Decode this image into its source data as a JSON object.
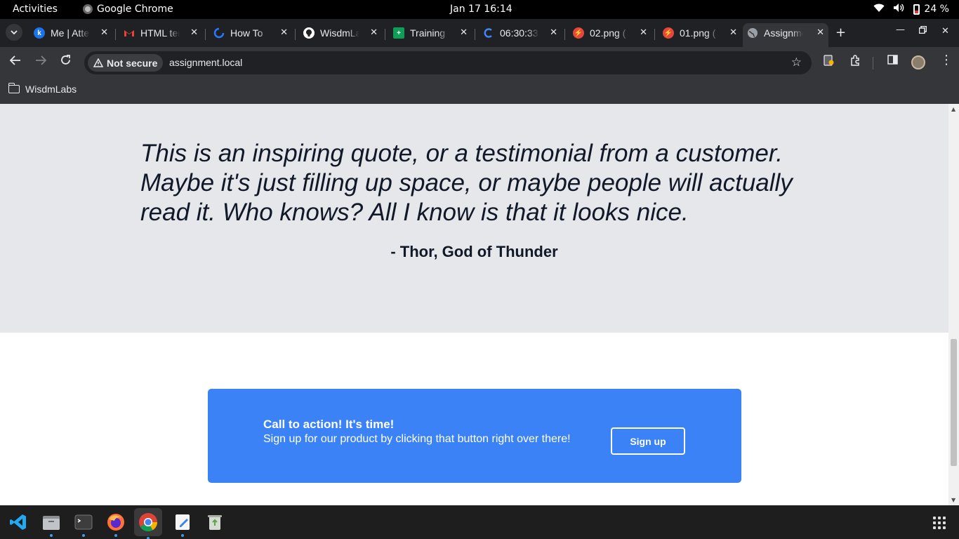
{
  "system": {
    "activities": "Activities",
    "app_name": "Google Chrome",
    "clock": "Jan 17  16:14",
    "battery": "24 %"
  },
  "tabs": [
    {
      "label": "Me | Attendance",
      "icon": "k",
      "color": "#1a73e8"
    },
    {
      "label": "HTML template",
      "icon": "M",
      "color": "#ea4335"
    },
    {
      "label": "How To",
      "icon": "~",
      "color": "#2979ff"
    },
    {
      "label": "WisdmLabs",
      "icon": "gh",
      "color": "#ffffff"
    },
    {
      "label": "Training",
      "icon": "+",
      "color": "#0f9d58"
    },
    {
      "label": "06:30:33",
      "icon": "C",
      "color": "#4285f4"
    },
    {
      "label": "02.png (",
      "icon": "⚡",
      "color": "#e8453c"
    },
    {
      "label": "01.png (",
      "icon": "⚡",
      "color": "#e8453c"
    },
    {
      "label": "Assignment",
      "icon": "globe",
      "color": "#9aa0a6"
    }
  ],
  "toolbar": {
    "security_label": "Not secure",
    "url": "assignment.local"
  },
  "bookmarks": {
    "folder_label": "WisdmLabs"
  },
  "page": {
    "quote": "This is an inspiring quote, or a testimonial from a customer. Maybe it's just filling up space, or maybe people will actually read it. Who knows? All I know is that it looks nice.",
    "author": "- Thor, God of Thunder",
    "cta_title": "Call to action! It's time!",
    "cta_subtitle": "Sign up for our product by clicking that button right over there!",
    "cta_button": "Sign up"
  },
  "colors": {
    "quote_bg": "#e5e7eb",
    "cta_bg": "#3b82f6",
    "text_dark": "#111827"
  }
}
